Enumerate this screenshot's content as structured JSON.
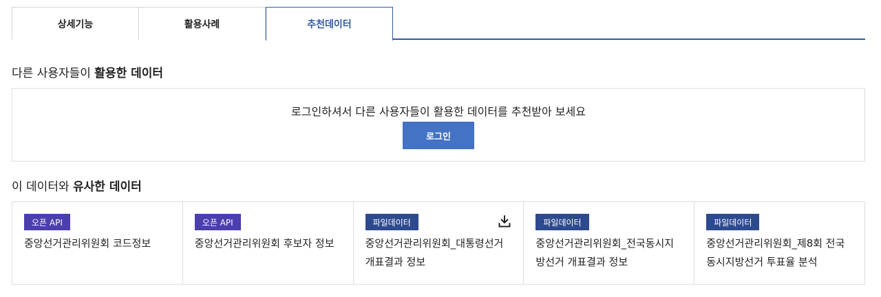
{
  "tabs": [
    {
      "label": "상세기능",
      "active": false
    },
    {
      "label": "활용사례",
      "active": false
    },
    {
      "label": "추천데이터",
      "active": true
    }
  ],
  "recommended": {
    "title_prefix": "다른 사용자들이 ",
    "title_bold": "활용한 데이터",
    "login_message": "로그인하셔서 다른 사용자들이 활용한 데이터를 추천받아 보세요",
    "login_button": "로그인"
  },
  "similar": {
    "title_prefix": "이 데이터와 ",
    "title_bold": "유사한 데이터",
    "cards": [
      {
        "badge": "오픈 API",
        "badge_type": "api",
        "title": "중앙선거관리위원회 코드정보",
        "download": false
      },
      {
        "badge": "오픈 API",
        "badge_type": "api",
        "title": "중앙선거관리위원회 후보자 정보",
        "download": false
      },
      {
        "badge": "파일데이터",
        "badge_type": "file",
        "title": "중앙선거관리위원회_대통령선거 개표결과 정보",
        "download": true,
        "download_icon": "download-icon"
      },
      {
        "badge": "파일데이터",
        "badge_type": "file",
        "title": "중앙선거관리위원회_전국동시지방선거 개표결과 정보",
        "download": false
      },
      {
        "badge": "파일데이터",
        "badge_type": "file",
        "title": "중앙선거관리위원회_제8회 전국동시지방선거 투표율 분석",
        "download": false
      }
    ]
  },
  "colors": {
    "accent": "#2f5aa0",
    "button": "#4472c4",
    "badge_api": "#4b3fae",
    "badge_file": "#2e4a8f"
  }
}
